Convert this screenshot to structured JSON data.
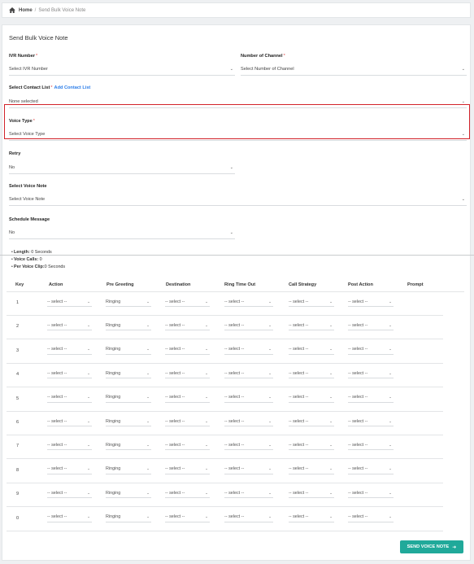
{
  "breadcrumb": {
    "home": "Home",
    "separator": "/",
    "current": "Send Bulk Voice Note"
  },
  "form": {
    "title": "Send Bulk Voice Note",
    "ivr_number": {
      "label": "IVR Number",
      "required": "*",
      "value": "Select IVR Number"
    },
    "channels": {
      "label": "Number of Channel",
      "required": "*",
      "value": "Select Number of Channel"
    },
    "contact_list": {
      "label": "Select Contact List",
      "required": "*",
      "link": "Add Contact List",
      "value": "None selected"
    },
    "voice_type": {
      "label": "Voice Type",
      "required": "*",
      "value": "Select Voice Type"
    },
    "retry": {
      "label": "Retry",
      "value": "No"
    },
    "voice_note": {
      "label": "Select Voice Note",
      "value": "Select Voice Note"
    },
    "schedule": {
      "label": "Schedule Message",
      "value": "No"
    }
  },
  "info": {
    "length_label": "Length:",
    "length_value": " 0 Seconds",
    "calls_label": "Voice Calls:",
    "calls_value": " 0",
    "clip_label": "Per Voice Clip:",
    "clip_value": "0 Seconds"
  },
  "table": {
    "headers": [
      "Key",
      "Action",
      "Pre Greeting",
      "Destination",
      "Ring Time Out",
      "Call Strategy",
      "Post Action",
      "Prompt"
    ],
    "rows": [
      {
        "key": "1"
      },
      {
        "key": "2"
      },
      {
        "key": "3"
      },
      {
        "key": "4"
      },
      {
        "key": "5"
      },
      {
        "key": "6"
      },
      {
        "key": "7"
      },
      {
        "key": "8"
      },
      {
        "key": "9"
      },
      {
        "key": "0"
      }
    ],
    "select_placeholder": "-- select --",
    "pre_greeting_value": "Ringing"
  },
  "submit": {
    "label": "SEND VOICE NOTE",
    "icon": "arrow-right-icon"
  },
  "colors": {
    "accent": "#20a99a",
    "highlight": "#d2232a",
    "link": "#2b7de9"
  }
}
